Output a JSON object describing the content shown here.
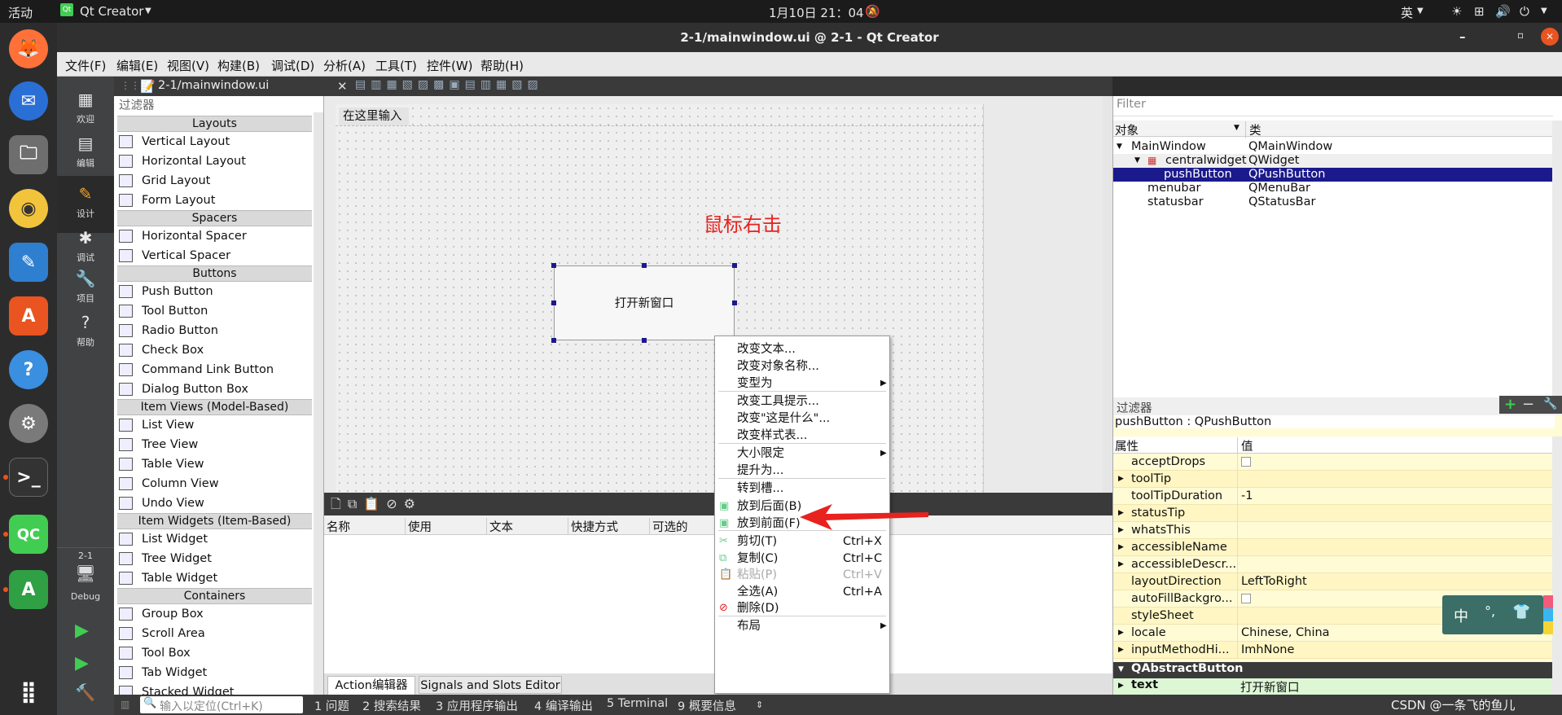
{
  "topbar": {
    "activities": "活动",
    "app_name": "Qt Creator",
    "clock": "1月10日 21：04",
    "input_method": "英"
  },
  "window": {
    "title": "2-1/mainwindow.ui @ 2-1 - Qt Creator"
  },
  "menu": [
    "文件(F)",
    "编辑(E)",
    "视图(V)",
    "构建(B)",
    "调试(D)",
    "分析(A)",
    "工具(T)",
    "控件(W)",
    "帮助(H)"
  ],
  "modes": [
    "欢迎",
    "编辑",
    "设计",
    "调试",
    "项目",
    "帮助"
  ],
  "kit": {
    "project": "2-1",
    "config": "Debug"
  },
  "file_tab": "2-1/mainwindow.ui",
  "widget_box": {
    "filter": "过滤器",
    "sections": [
      {
        "title": "Layouts",
        "items": [
          "Vertical Layout",
          "Horizontal Layout",
          "Grid Layout",
          "Form Layout"
        ]
      },
      {
        "title": "Spacers",
        "items": [
          "Horizontal Spacer",
          "Vertical Spacer"
        ]
      },
      {
        "title": "Buttons",
        "items": [
          "Push Button",
          "Tool Button",
          "Radio Button",
          "Check Box",
          "Command Link Button",
          "Dialog Button Box"
        ]
      },
      {
        "title": "Item Views (Model-Based)",
        "items": [
          "List View",
          "Tree View",
          "Table View",
          "Column View",
          "Undo View"
        ]
      },
      {
        "title": "Item Widgets (Item-Based)",
        "items": [
          "List Widget",
          "Tree Widget",
          "Table Widget"
        ]
      },
      {
        "title": "Containers",
        "items": [
          "Group Box",
          "Scroll Area",
          "Tool Box",
          "Tab Widget",
          "Stacked Widget"
        ]
      }
    ]
  },
  "form": {
    "menu_placeholder": "在这里输入",
    "annotation": "鼠标右击",
    "button_text": "打开新窗口"
  },
  "action_editor": {
    "columns": [
      "名称",
      "使用",
      "文本",
      "快捷方式",
      "可选的"
    ],
    "tabs": [
      "Action编辑器",
      "Signals and Slots Editor"
    ]
  },
  "object_inspector": {
    "filter": "Filter",
    "col_object": "对象",
    "col_class": "类",
    "rows": [
      {
        "name": "MainWindow",
        "cls": "QMainWindow"
      },
      {
        "name": "centralwidget",
        "cls": "QWidget"
      },
      {
        "name": "pushButton",
        "cls": "QPushButton"
      },
      {
        "name": "menubar",
        "cls": "QMenuBar"
      },
      {
        "name": "statusbar",
        "cls": "QStatusBar"
      }
    ]
  },
  "property_editor": {
    "filter": "过滤器",
    "object_label": "pushButton : QPushButton",
    "col_prop": "属性",
    "col_value": "值",
    "rows": [
      {
        "name": "acceptDrops",
        "value": ""
      },
      {
        "name": "toolTip",
        "value": ""
      },
      {
        "name": "toolTipDuration",
        "value": "-1"
      },
      {
        "name": "statusTip",
        "value": ""
      },
      {
        "name": "whatsThis",
        "value": ""
      },
      {
        "name": "accessibleName",
        "value": ""
      },
      {
        "name": "accessibleDescr...",
        "value": ""
      },
      {
        "name": "layoutDirection",
        "value": "LeftToRight"
      },
      {
        "name": "autoFillBackgro...",
        "value": ""
      },
      {
        "name": "styleSheet",
        "value": ""
      },
      {
        "name": "locale",
        "value": "Chinese, China"
      },
      {
        "name": "inputMethodHi...",
        "value": "ImhNone"
      }
    ],
    "section": "QAbstractButton",
    "text_prop": "text",
    "text_value": "打开新窗口"
  },
  "context_menu": {
    "items": [
      {
        "label": "改变文本...",
        "shortcut": ""
      },
      {
        "label": "改变对象名称...",
        "shortcut": ""
      },
      {
        "label": "变型为",
        "shortcut": ""
      },
      {
        "label": "改变工具提示...",
        "shortcut": ""
      },
      {
        "label": "改变\"这是什么\"...",
        "shortcut": ""
      },
      {
        "label": "改变样式表...",
        "shortcut": ""
      },
      {
        "label": "大小限定",
        "shortcut": ""
      },
      {
        "label": "提升为...",
        "shortcut": ""
      },
      {
        "label": "转到槽...",
        "shortcut": ""
      },
      {
        "label": "放到后面(B)",
        "shortcut": ""
      },
      {
        "label": "放到前面(F)",
        "shortcut": ""
      },
      {
        "label": "剪切(T)",
        "shortcut": "Ctrl+X"
      },
      {
        "label": "复制(C)",
        "shortcut": "Ctrl+C"
      },
      {
        "label": "粘贴(P)",
        "shortcut": "Ctrl+V"
      },
      {
        "label": "全选(A)",
        "shortcut": "Ctrl+A"
      },
      {
        "label": "删除(D)",
        "shortcut": ""
      },
      {
        "label": "布局",
        "shortcut": ""
      }
    ]
  },
  "bottom_bar": {
    "locator_placeholder": "输入以定位(Ctrl+K)",
    "panes": [
      "1 问题",
      "2 搜索结果",
      "3 应用程序输出",
      "4 编译输出",
      "5 Terminal",
      "9 概要信息"
    ]
  },
  "ime_widget": {
    "label": "中"
  },
  "watermark": "CSDN @一条飞的鱼儿",
  "colors": {
    "accent": "#e8221e",
    "selection": "#1a1a8c",
    "qt_green": "#41cd52"
  }
}
